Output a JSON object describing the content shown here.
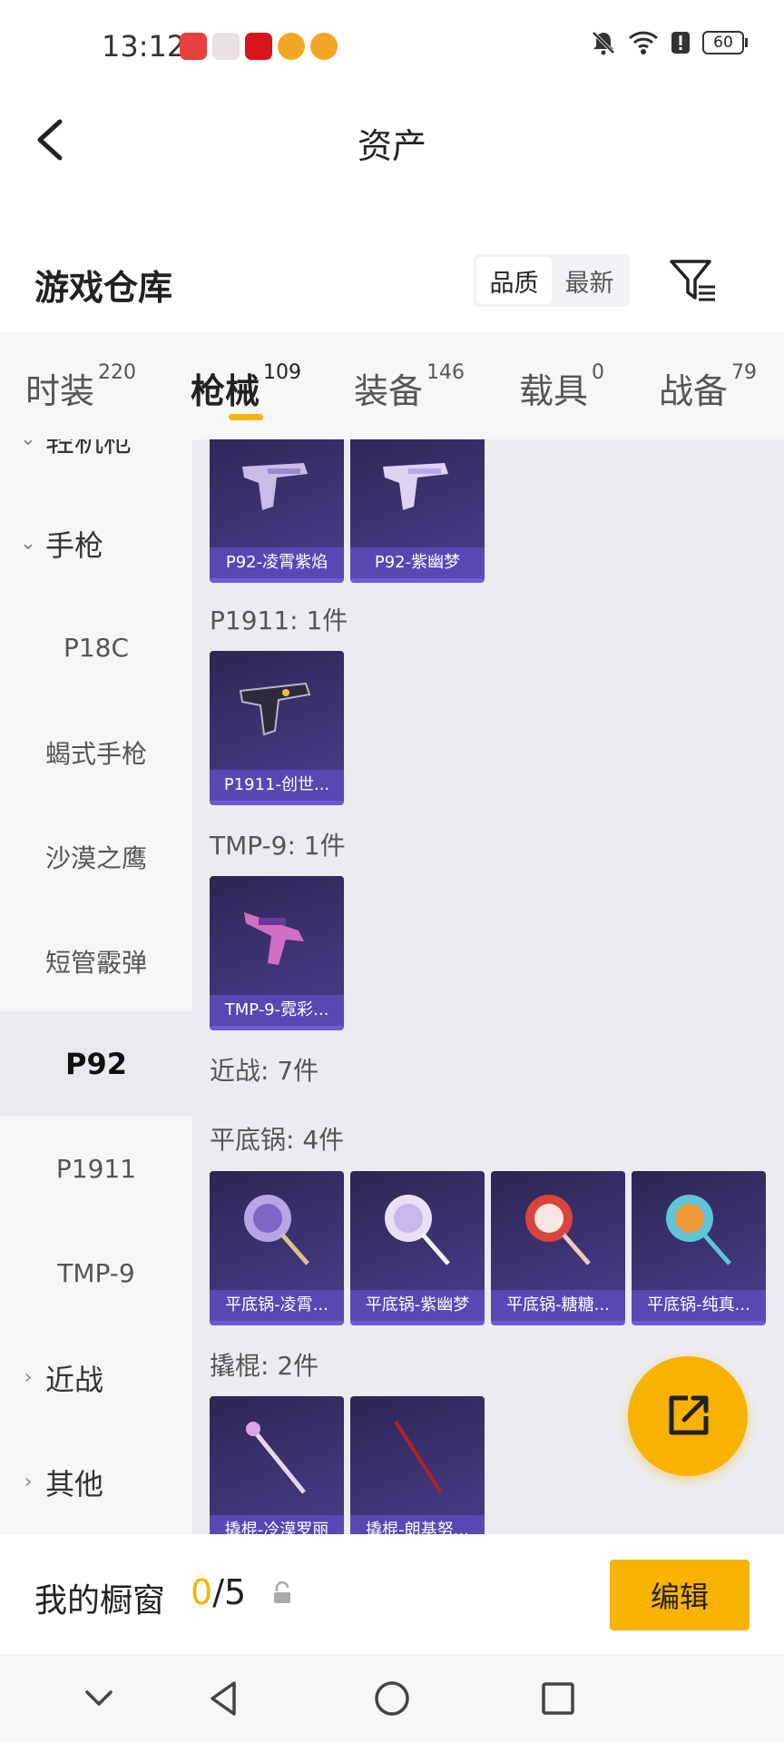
{
  "status_bar": {
    "time": "13:12",
    "battery": "60",
    "app_icons": [
      "huawei-store-icon",
      "gift-box-icon",
      "red-app-icon",
      "orange-app-icon",
      "orange-app-icon"
    ]
  },
  "header": {
    "title": "资产",
    "back_icon": "chevron-left-icon"
  },
  "warehouse": {
    "title": "游戏仓库",
    "sort_options": [
      "品质",
      "最新"
    ],
    "sort_selected": "品质",
    "filter_icon": "filter-icon"
  },
  "tabs": [
    {
      "label": "时装",
      "count": "220",
      "active": false
    },
    {
      "label": "枪械",
      "count": "109",
      "active": true
    },
    {
      "label": "装备",
      "count": "146",
      "active": false
    },
    {
      "label": "载具",
      "count": "0",
      "active": false
    },
    {
      "label": "战备",
      "count": "79",
      "active": false
    }
  ],
  "sidebar": {
    "partial_item": "轻机枪",
    "items": [
      {
        "label": "手枪",
        "type": "group",
        "expanded": true
      },
      {
        "label": "P18C",
        "type": "sub"
      },
      {
        "label": "蝎式手枪",
        "type": "sub"
      },
      {
        "label": "沙漠之鹰",
        "type": "sub"
      },
      {
        "label": "短管霰弹",
        "type": "sub"
      },
      {
        "label": "P92",
        "type": "sub",
        "selected": true
      },
      {
        "label": "P1911",
        "type": "sub"
      },
      {
        "label": "TMP-9",
        "type": "sub"
      },
      {
        "label": "近战",
        "type": "group",
        "expanded": false
      },
      {
        "label": "其他",
        "type": "group",
        "expanded": false
      }
    ]
  },
  "content": {
    "p92_cards": [
      {
        "name": "P92-凌霄紫焰"
      },
      {
        "name": "P92-紫幽梦"
      }
    ],
    "sections": [
      {
        "label": "P1911: 1件",
        "cards": [
          {
            "name": "P1911-创世..."
          }
        ]
      },
      {
        "label": "TMP-9: 1件",
        "cards": [
          {
            "name": "TMP-9-霓彩..."
          }
        ]
      },
      {
        "label": "近战: 7件"
      },
      {
        "label": "平底锅: 4件",
        "cards": [
          {
            "name": "平底锅-凌霄..."
          },
          {
            "name": "平底锅-紫幽梦"
          },
          {
            "name": "平底锅-糖糖..."
          },
          {
            "name": "平底锅-纯真..."
          }
        ]
      },
      {
        "label": "撬棍: 2件",
        "cards": [
          {
            "name": "撬棍-冷漠罗丽"
          },
          {
            "name": "撬棍-朗基努..."
          }
        ]
      }
    ]
  },
  "fab": {
    "icon": "share-edit-icon"
  },
  "showcase": {
    "label": "我的橱窗",
    "current": "0",
    "total": "/5",
    "edit_label": "编辑"
  },
  "colors": {
    "accent": "#f8b200",
    "card_bg": "#3f3577",
    "card_label_bg": "#5a47b3"
  }
}
